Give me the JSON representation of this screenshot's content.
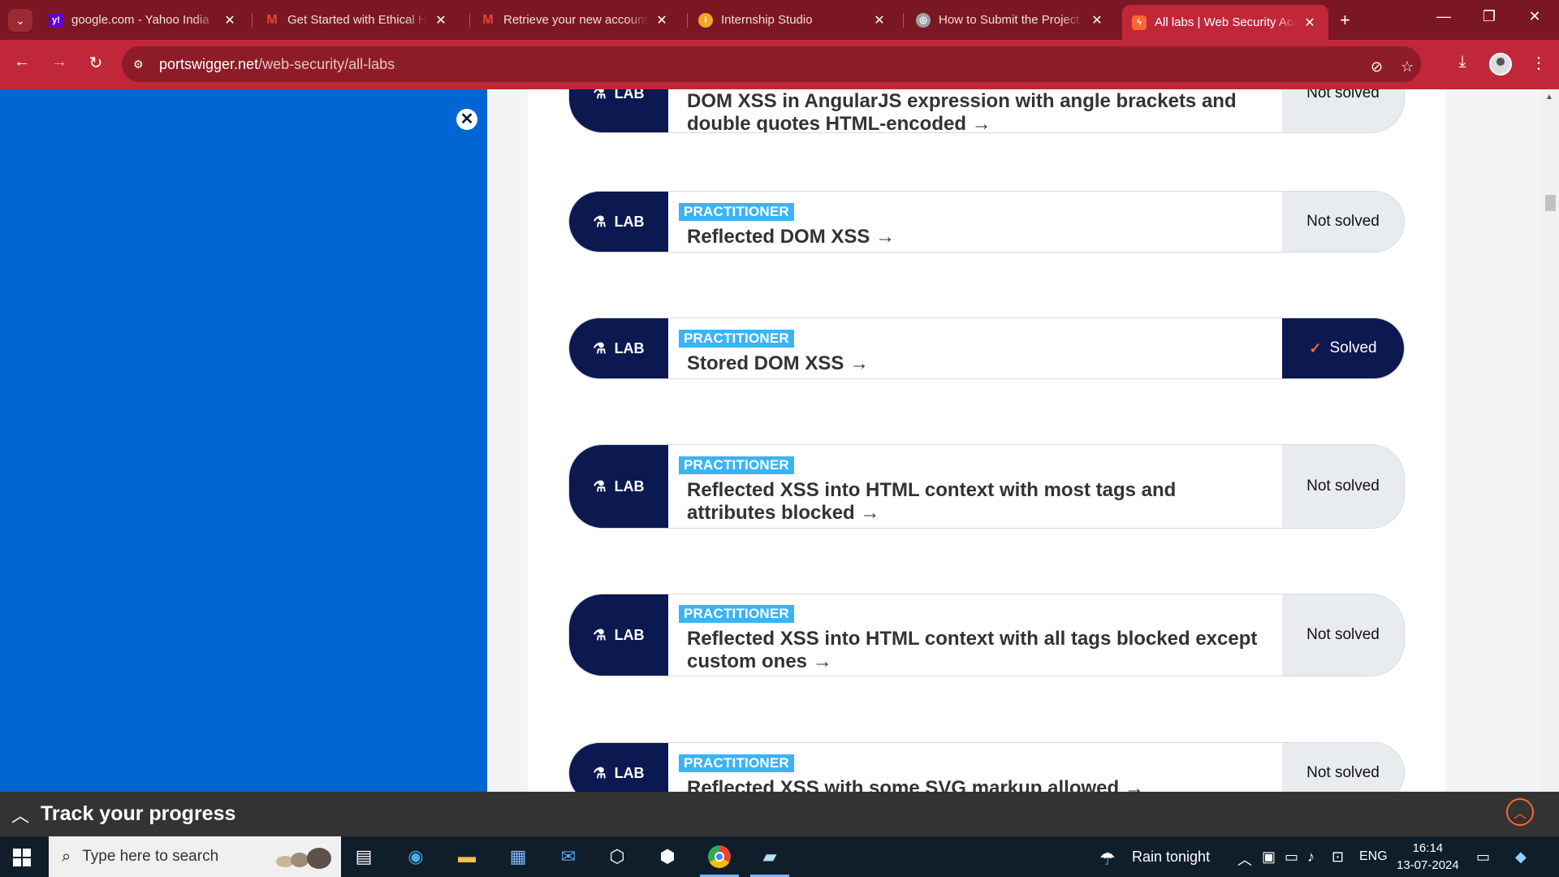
{
  "browser": {
    "tabs": [
      {
        "title": "google.com - Yahoo India",
        "favicon": "yahoo-icon",
        "color": "#6001d2",
        "glyph": "y!"
      },
      {
        "title": "Get Started with Ethical Ha",
        "favicon": "gmail-icon",
        "color": "#ea4335",
        "glyph": "M"
      },
      {
        "title": "Retrieve your new account",
        "favicon": "gmail-icon",
        "color": "#ea4335",
        "glyph": "M"
      },
      {
        "title": "Internship Studio",
        "favicon": "internship-studio-icon",
        "color": "#f5a623",
        "glyph": "i"
      },
      {
        "title": "How to Submit the Project",
        "favicon": "globe-icon",
        "color": "#9aa0a6",
        "glyph": "◎"
      },
      {
        "title": "All labs | Web Security Aca",
        "favicon": "portswigger-icon",
        "color": "#ff6633",
        "glyph": "ϟ"
      }
    ],
    "url_host": "portswigger.net",
    "url_path": "/web-security/all-labs"
  },
  "labs": [
    {
      "level": "",
      "title": "DOM XSS in AngularJS expression with angle brackets and double quotes HTML-encoded →",
      "status": "Not solved",
      "solved": false
    },
    {
      "level": "PRACTITIONER",
      "title": "Reflected DOM XSS →",
      "status": "Not solved",
      "solved": false
    },
    {
      "level": "PRACTITIONER",
      "title": "Stored DOM XSS →",
      "status": "Solved",
      "solved": true
    },
    {
      "level": "PRACTITIONER",
      "title": "Reflected XSS into HTML context with most tags and attributes blocked →",
      "status": "Not solved",
      "solved": false
    },
    {
      "level": "PRACTITIONER",
      "title": "Reflected XSS into HTML context with all tags blocked except custom ones →",
      "status": "Not solved",
      "solved": false
    },
    {
      "level": "PRACTITIONER",
      "title": "Reflected XSS with some SVG markup allowed →",
      "status": "Not solved",
      "solved": false
    }
  ],
  "lab_label": "LAB",
  "progress": {
    "label": "Track your progress"
  },
  "taskbar": {
    "search_placeholder": "Type here to search",
    "weather": "Rain tonight",
    "language": "ENG",
    "time": "16:14",
    "date": "13-07-2024"
  },
  "colors": {
    "brand": "#ff6633",
    "navy": "#0b1950",
    "sidebar": "#0066d4",
    "badge": "#3bb3f5",
    "chrome_tab": "#c0283a"
  }
}
